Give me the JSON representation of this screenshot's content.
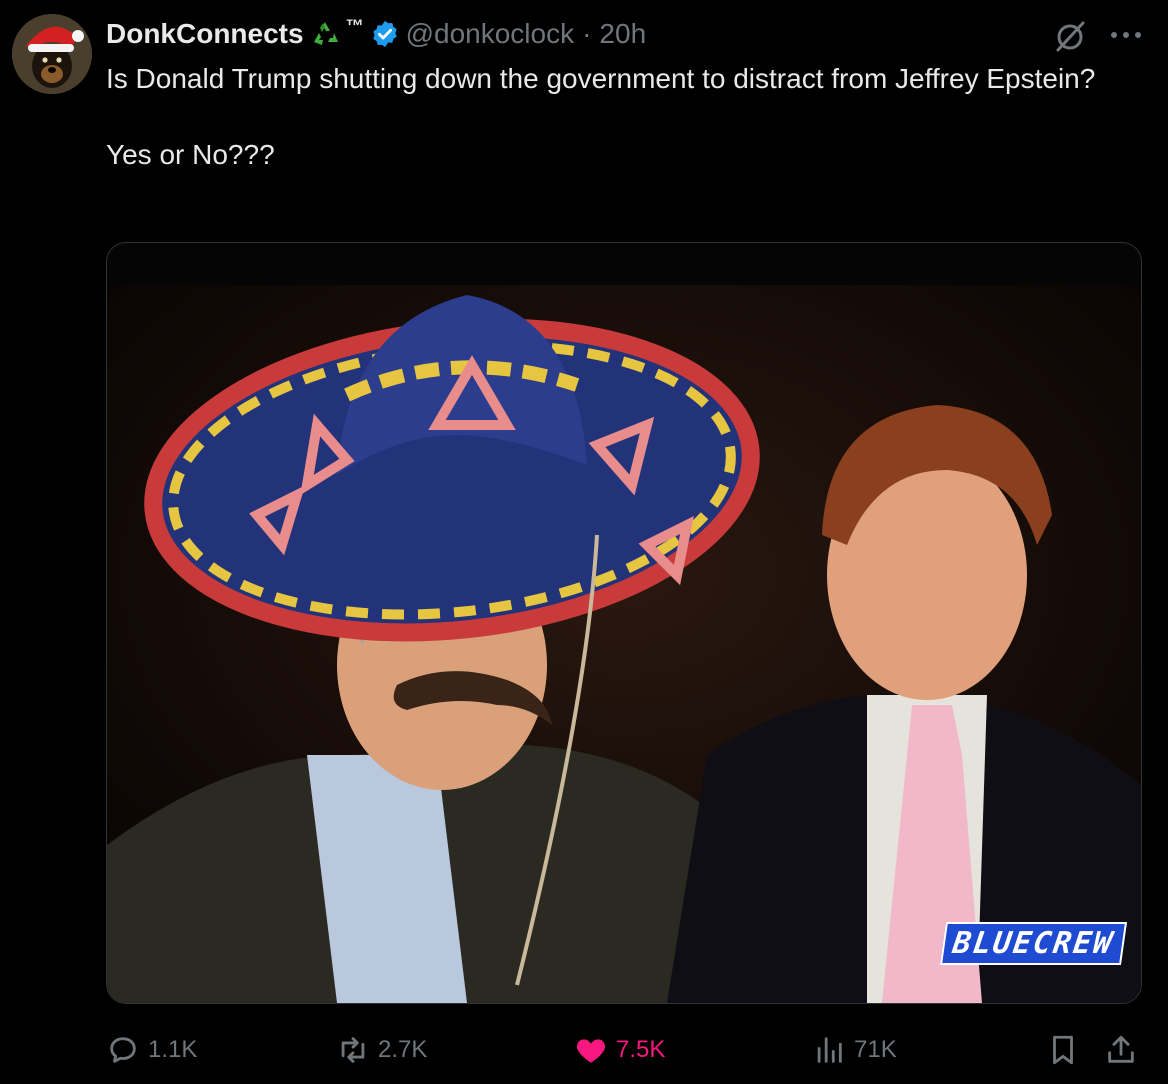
{
  "author": {
    "display_name": "DonkConnects",
    "name_suffix": "™",
    "handle": "@donkoclock",
    "separator": "·",
    "timestamp": "20h",
    "verified": true,
    "badge_icon": "recycling-symbol"
  },
  "tweet": {
    "text": "Is Donald Trump shutting down the government to distract from Jeffrey Epstein?\n\nYes or No???"
  },
  "media": {
    "type": "photo",
    "watermark": "BLUECREW"
  },
  "actions": {
    "reply": {
      "icon": "reply-icon",
      "count": "1.1K"
    },
    "repost": {
      "icon": "repost-icon",
      "count": "2.7K"
    },
    "like": {
      "icon": "heart-icon",
      "count": "7.5K",
      "liked": true
    },
    "views": {
      "icon": "views-icon",
      "count": "71K"
    },
    "bookmark": {
      "icon": "bookmark-icon"
    },
    "share": {
      "icon": "share-icon"
    }
  },
  "colors": {
    "background": "#000000",
    "text_primary": "#e7e9ea",
    "text_secondary": "#71767b",
    "verified_blue": "#1d9bf0",
    "like_pink": "#f91880",
    "border": "#2f3336"
  }
}
